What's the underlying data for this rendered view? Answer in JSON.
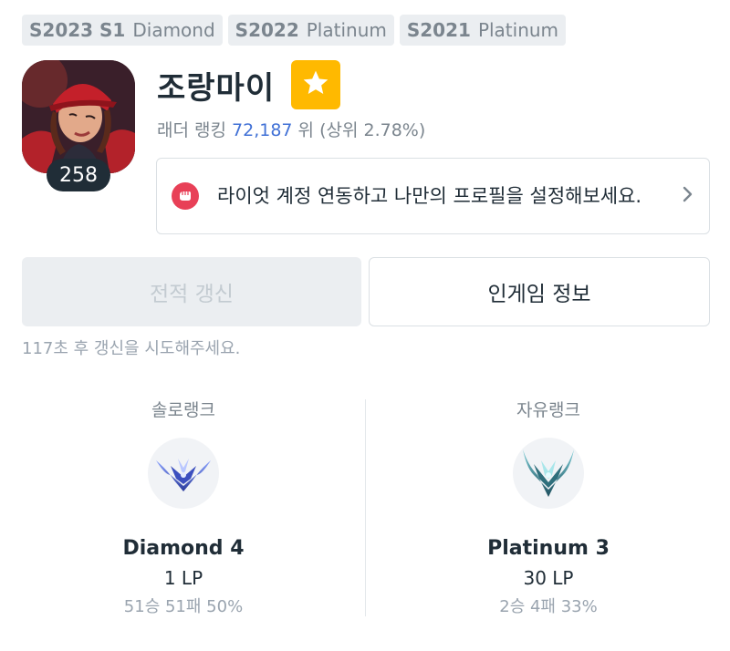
{
  "seasons": [
    {
      "year": "S2023 S1",
      "tier": "Diamond"
    },
    {
      "year": "S2022",
      "tier": "Platinum"
    },
    {
      "year": "S2021",
      "tier": "Platinum"
    }
  ],
  "profile": {
    "name": "조랑마이",
    "level": "258",
    "ladder_prefix": "래더 랭킹",
    "ladder_rank": "72,187",
    "ladder_suffix": "위 (상위 2.78%)"
  },
  "riot_banner": {
    "text": "라이엇 계정 연동하고 나만의 프로필을 설정해보세요."
  },
  "buttons": {
    "refresh": "전적 갱신",
    "ingame": "인게임 정보"
  },
  "refresh_note": "117초 후 갱신을 시도해주세요.",
  "ranks": {
    "solo": {
      "title": "솔로랭크",
      "tier": "Diamond 4",
      "lp": "1 LP",
      "record": "51승 51패 50%"
    },
    "flex": {
      "title": "자유랭크",
      "tier": "Platinum 3",
      "lp": "30 LP",
      "record": "2승 4패 33%"
    }
  },
  "colors": {
    "favorite": "#ffb900",
    "riot_red": "#e84057",
    "rank_link": "#4171d6"
  },
  "icons": {
    "favorite": "star-icon",
    "riot": "riot-fist-icon",
    "chevron": "chevron-right-icon",
    "solo_emblem": "diamond-emblem-icon",
    "flex_emblem": "platinum-emblem-icon"
  }
}
